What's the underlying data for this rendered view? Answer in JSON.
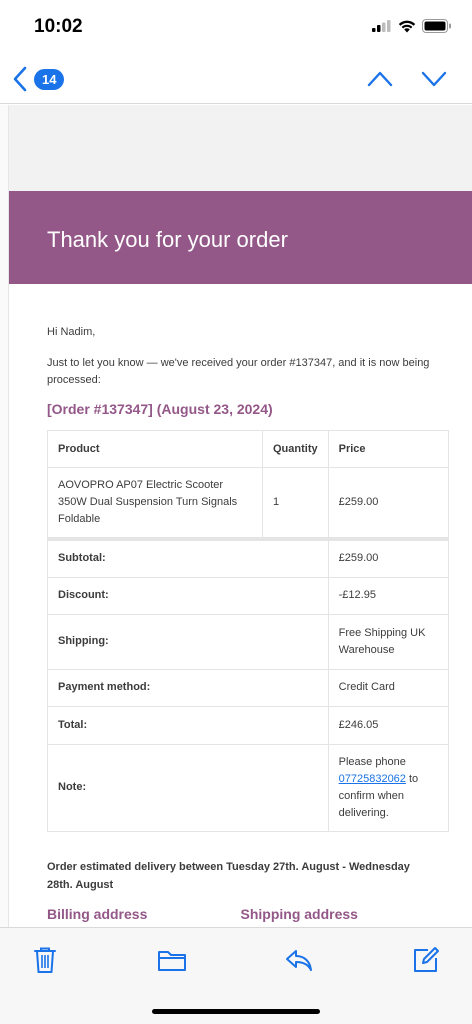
{
  "status_bar": {
    "time": "10:02"
  },
  "nav": {
    "badge_count": "14"
  },
  "email": {
    "header_title": "Thank you for your order",
    "greeting": "Hi Nadim,",
    "intro": "Just to let you know — we've received your order #137347, and it is now being processed:",
    "order_heading": "[Order #137347] (August 23, 2024)",
    "table": {
      "headers": {
        "product": "Product",
        "quantity": "Quantity",
        "price": "Price"
      },
      "item": {
        "product": "AOVOPRO AP07 Electric Scooter 350W Dual Suspension Turn Signals Foldable",
        "quantity": "1",
        "price": "£259.00"
      },
      "totals": [
        {
          "label": "Subtotal:",
          "value": "£259.00"
        },
        {
          "label": "Discount:",
          "value": "-£12.95"
        },
        {
          "label": "Shipping:",
          "value": "Free Shipping UK Warehouse"
        },
        {
          "label": "Payment method:",
          "value": "Credit Card"
        },
        {
          "label": "Total:",
          "value": "£246.05"
        }
      ],
      "note": {
        "label": "Note:",
        "text_before": "Please phone ",
        "phone": "07725832062",
        "text_after": " to confirm when delivering."
      }
    },
    "delivery": "Order estimated delivery between Tuesday 27th. August - Wednesday 28th. August",
    "billing_title": "Billing address",
    "shipping_title": "Shipping address"
  },
  "colors": {
    "accent": "#935788",
    "link": "#1a73e8",
    "ios_blue": "#1a73e8"
  },
  "toolbar": {
    "icons": [
      "trash-icon",
      "folder-icon",
      "reply-icon",
      "compose-icon"
    ]
  }
}
